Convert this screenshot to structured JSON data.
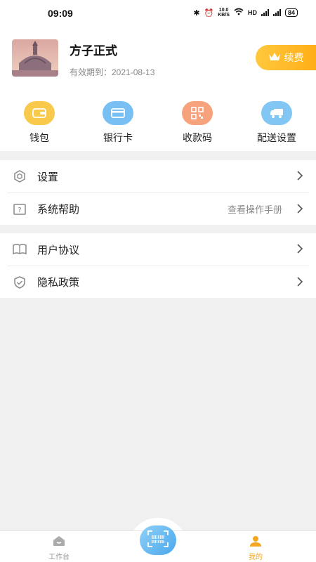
{
  "status_bar": {
    "time": "09:09",
    "net_speed_value": "10.0",
    "net_speed_unit": "KB/S",
    "network": "HD",
    "battery": "84"
  },
  "profile": {
    "name": "方子正式",
    "expiry": "有效期到：2021-08-13",
    "renew_label": "续费"
  },
  "quick_actions": [
    {
      "label": "钱包",
      "icon": "wallet-icon",
      "color": "#f9c94b"
    },
    {
      "label": "银行卡",
      "icon": "bank-card-icon",
      "color": "#78bff3"
    },
    {
      "label": "收款码",
      "icon": "qr-code-icon",
      "color": "#f6a37d"
    },
    {
      "label": "配送设置",
      "icon": "delivery-truck-icon",
      "color": "#82c6f4"
    }
  ],
  "menu_group_1": [
    {
      "label": "设置",
      "icon": "hexagon-settings-icon",
      "hint": ""
    },
    {
      "label": "系统帮助",
      "icon": "help-question-icon",
      "hint": "查看操作手册"
    }
  ],
  "menu_group_2": [
    {
      "label": "用户协议",
      "icon": "book-icon",
      "hint": ""
    },
    {
      "label": "隐私政策",
      "icon": "shield-check-icon",
      "hint": ""
    }
  ],
  "tab_bar": {
    "tabs": [
      {
        "label": "工作台",
        "icon": "home-icon",
        "active": false,
        "color": "#999999"
      },
      {
        "label": "我的",
        "icon": "user-icon",
        "active": true,
        "color": "#f5a623"
      }
    ],
    "center_button": "scan-icon"
  }
}
